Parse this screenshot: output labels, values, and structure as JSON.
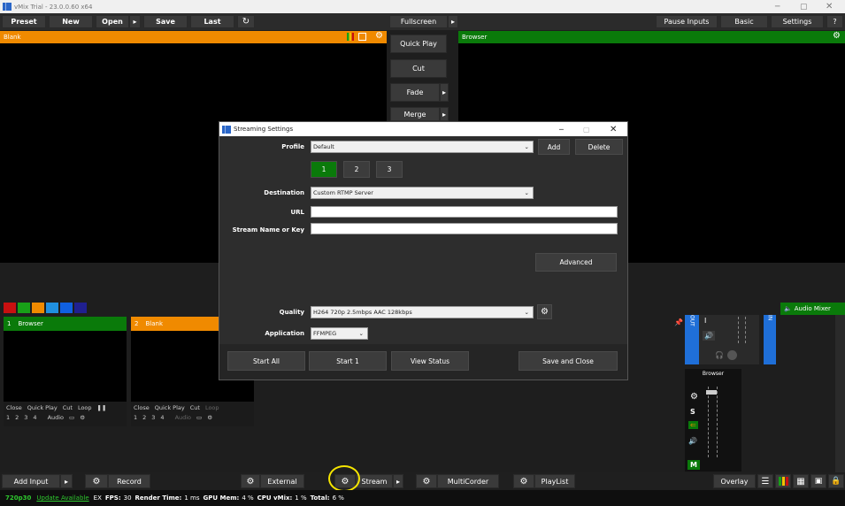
{
  "app": {
    "title": "vMix Trial - 23.0.0.60 x64"
  },
  "toolbar": {
    "preset": "Preset",
    "new": "New",
    "open": "Open",
    "save": "Save",
    "last": "Last",
    "fullscreen": "Fullscreen",
    "pause_inputs": "Pause Inputs",
    "basic": "Basic",
    "settings": "Settings",
    "help": "?"
  },
  "preview": {
    "title": "Blank"
  },
  "output": {
    "title": "Browser"
  },
  "transitions": {
    "quick_play": "Quick Play",
    "cut": "Cut",
    "fade": "Fade",
    "merge": "Merge"
  },
  "dialog": {
    "title": "Streaming Settings",
    "profile_label": "Profile",
    "profile_value": "Default",
    "add": "Add",
    "delete": "Delete",
    "tabs": [
      "1",
      "2",
      "3"
    ],
    "destination_label": "Destination",
    "destination_value": "Custom RTMP Server",
    "url_label": "URL",
    "url_value": "",
    "key_label": "Stream Name or Key",
    "key_value": "",
    "advanced": "Advanced",
    "quality_label": "Quality",
    "quality_value": "H264 720p 2.5mbps AAC 128kbps",
    "application_label": "Application",
    "application_value": "FFMPEG",
    "start_all": "Start All",
    "start_1": "Start 1",
    "view_status": "View Status",
    "save_close": "Save and Close"
  },
  "inputs": [
    {
      "num": "1",
      "name": "Browser",
      "color": "#0a7a0a",
      "buttons": [
        "Close",
        "Quick Play",
        "Cut",
        "Loop"
      ],
      "nums": [
        "1",
        "2",
        "3",
        "4"
      ],
      "audio": "Audio"
    },
    {
      "num": "2",
      "name": "Blank",
      "color": "#f08a00",
      "buttons": [
        "Close",
        "Quick Play",
        "Cut",
        "Loop"
      ],
      "nums": [
        "1",
        "2",
        "3",
        "4"
      ],
      "audio": "Audio"
    }
  ],
  "color_swatches": [
    "#c81010",
    "#18a018",
    "#f08a00",
    "#2090e0",
    "#1060e0",
    "#202090"
  ],
  "audio_mixer": {
    "title": "Audio Mixer",
    "out": "OUT",
    "in": "IN",
    "browser": "Browser",
    "s": "S",
    "m": "M",
    "i": "I"
  },
  "bottombar": {
    "add_input": "Add Input",
    "record": "Record",
    "external": "External",
    "stream": "Stream",
    "multicorder": "MultiCorder",
    "playlist": "PlayList",
    "overlay": "Overlay"
  },
  "status": {
    "format": "720p30",
    "update": "Update Available",
    "ex": "EX",
    "fps_label": "FPS:",
    "fps": "30",
    "render_label": "Render Time:",
    "render": "1 ms",
    "gpu_label": "GPU Mem:",
    "gpu": "4 %",
    "cpu_label": "CPU vMix:",
    "cpu": "1 %",
    "total_label": "Total:",
    "total": "6 %"
  }
}
